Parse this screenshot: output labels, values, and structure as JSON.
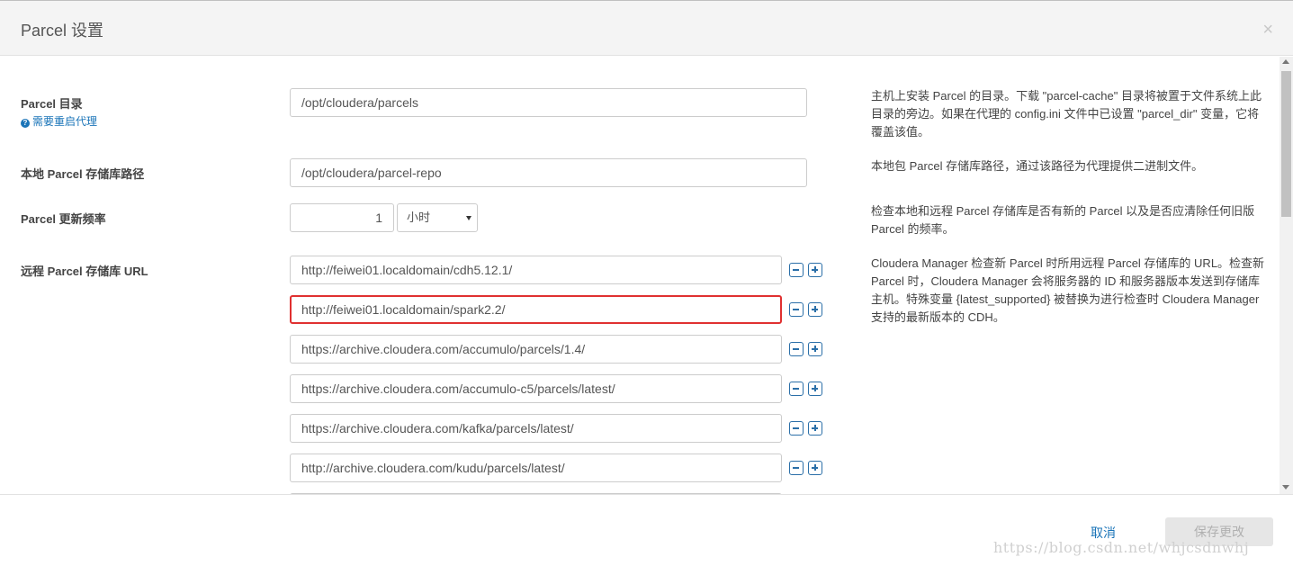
{
  "dialog": {
    "title": "Parcel 设置",
    "close_glyph": "×"
  },
  "fields": {
    "parcel_dir": {
      "label": "Parcel 目录",
      "note": "需要重启代理",
      "value": "/opt/cloudera/parcels",
      "desc": "主机上安装 Parcel 的目录。下载 \"parcel-cache\" 目录将被置于文件系统上此目录的旁边。如果在代理的 config.ini 文件中已设置 \"parcel_dir\" 变量，它将覆盖该值。"
    },
    "local_repo": {
      "label": "本地 Parcel 存储库路径",
      "value": "/opt/cloudera/parcel-repo",
      "desc": "本地包 Parcel 存储库路径，通过该路径为代理提供二进制文件。"
    },
    "update_freq": {
      "label": "Parcel 更新频率",
      "value": "1",
      "unit": "小时",
      "desc": "检查本地和远程 Parcel 存储库是否有新的 Parcel 以及是否应清除任何旧版 Parcel 的频率。"
    },
    "remote_urls": {
      "label": "远程 Parcel 存储库 URL",
      "desc": "Cloudera Manager 检查新 Parcel 时所用远程 Parcel 存储库的 URL。检查新 Parcel 时，Cloudera Manager 会将服务器的 ID 和服务器版本发送到存储库主机。特殊变量 {latest_supported} 被替换为进行检查时 Cloudera Manager 支持的最新版本的 CDH。",
      "items": [
        "http://feiwei01.localdomain/cdh5.12.1/",
        "http://feiwei01.localdomain/spark2.2/",
        "https://archive.cloudera.com/accumulo/parcels/1.4/",
        "https://archive.cloudera.com/accumulo-c5/parcels/latest/",
        "https://archive.cloudera.com/kafka/parcels/latest/",
        "http://archive.cloudera.com/kudu/parcels/latest/",
        ""
      ]
    }
  },
  "footer": {
    "cancel_label": "取消",
    "save_label": "保存更改",
    "watermark": "https://blog.csdn.net/whjcsdnwhj"
  }
}
